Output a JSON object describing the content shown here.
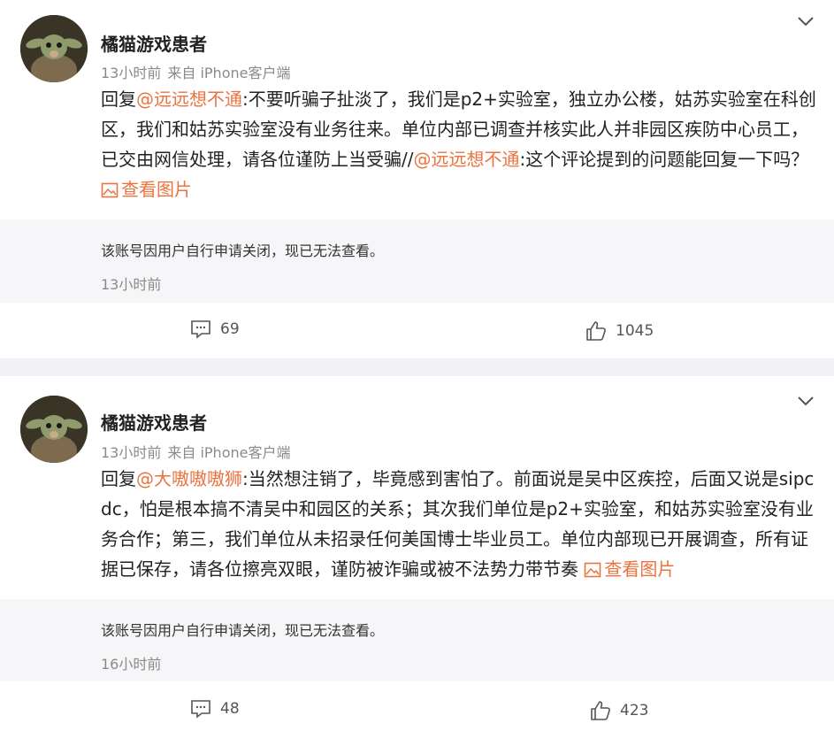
{
  "posts": [
    {
      "username": "橘猫游戏患者",
      "time": "13小时前",
      "source": "来自 iPhone客户端",
      "reply_prefix": "回复",
      "mention": "@远远想不通",
      "text": ":不要听骗子扯淡了，我们是p2+实验室，独立办公楼，姑苏实验室在科创区，我们和姑苏实验室没有业务往来。单位内部已调查并核实此人并非园区疾防中心员工，已交由网信处理，请各位谨防上当受骗//",
      "mention2": "@远远想不通",
      "text2": ":这个评论提到的问题能回复一下吗？",
      "view_pic": "查看图片",
      "quote_text": "该账号因用户自行申请关闭，现已无法查看。",
      "quote_time": "13小时前",
      "comments": "69",
      "likes": "1045"
    },
    {
      "username": "橘猫游戏患者",
      "time": "13小时前",
      "source": "来自 iPhone客户端",
      "reply_prefix": "回复",
      "mention": "@大嗷嗷嗷狮",
      "text": ":当然想注销了，毕竟感到害怕了。前面说是吴中区疾控，后面又说是sipcdc，怕是根本搞不清吴中和园区的关系；其次我们单位是p2+实验室，和姑苏实验室没有业务合作；第三，我们单位从未招录任何美国博士毕业员工。单位内部现已开展调查，所有证据已保存，请各位擦亮双眼，谨防被诈骗或被不法势力带节奏",
      "view_pic": "查看图片",
      "quote_text": "该账号因用户自行申请关闭，现已无法查看。",
      "quote_time": "16小时前",
      "comments": "48",
      "likes": "423"
    }
  ],
  "icons": {
    "avatar": "avatar-image",
    "chevron": "chevron-down-icon",
    "picture": "picture-icon",
    "comment": "comment-icon",
    "like": "thumbs-up-icon"
  },
  "colors": {
    "mention": "#eb7340",
    "background": "#f1f2f5"
  }
}
